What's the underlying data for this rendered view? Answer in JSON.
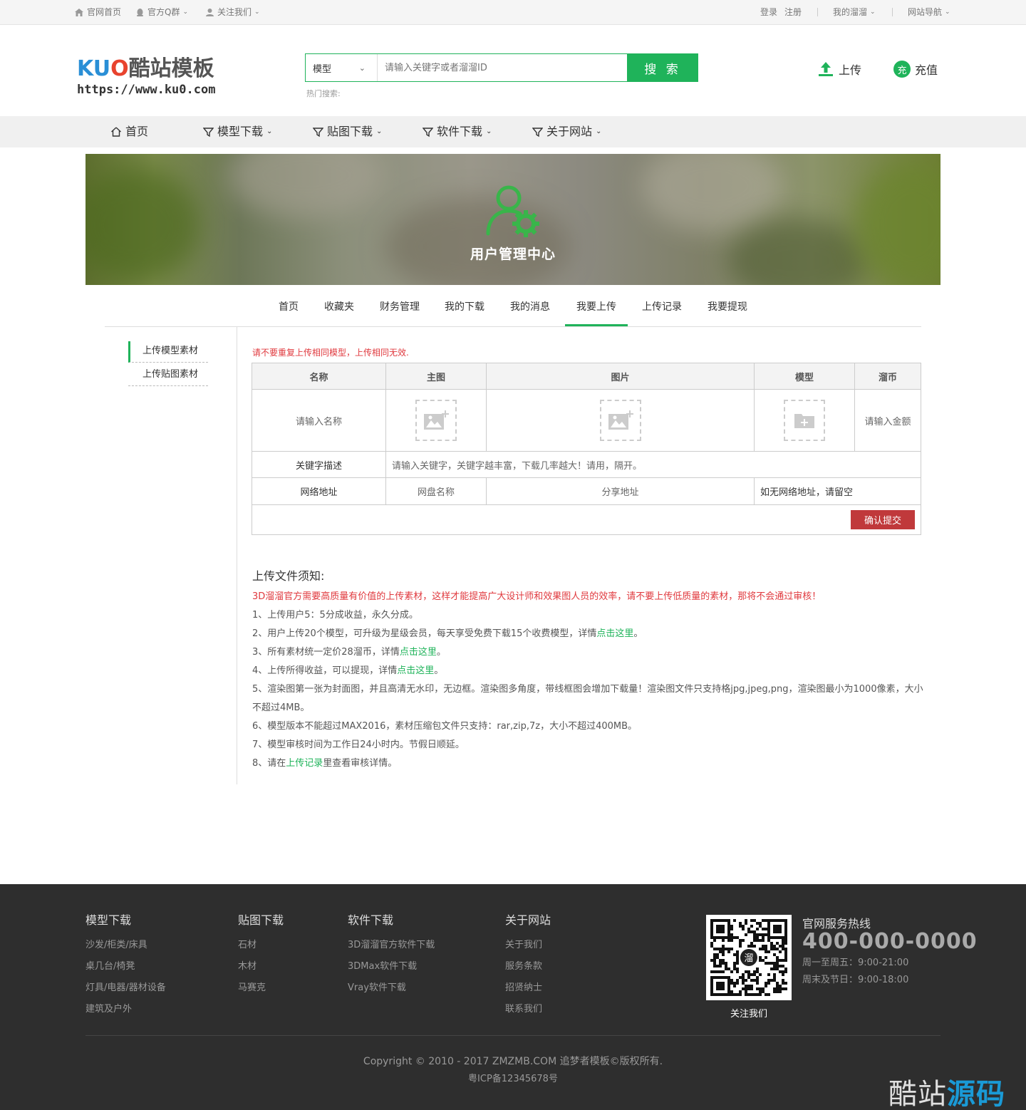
{
  "topbar": {
    "home": "官网首页",
    "qq": "官方Q群",
    "follow": "关注我们",
    "login": "登录",
    "register": "注册",
    "my": "我的溜溜",
    "nav": "网站导航"
  },
  "header": {
    "logo_text": "KUO酷站模板",
    "logo_url": "https://www.ku0.com",
    "search_category": "模型",
    "search_placeholder": "请输入关键字或者溜溜ID",
    "search_button": "搜 索",
    "hot_search": "热门搜索:",
    "upload": "上传",
    "recharge_badge": "充",
    "recharge": "充值"
  },
  "nav": [
    {
      "label": "首页"
    },
    {
      "label": "模型下载"
    },
    {
      "label": "贴图下载"
    },
    {
      "label": "软件下载"
    },
    {
      "label": "关于网站"
    }
  ],
  "banner": {
    "title": "用户管理中心"
  },
  "tabs": [
    "首页",
    "收藏夹",
    "财务管理",
    "我的下载",
    "我的消息",
    "我要上传",
    "上传记录",
    "我要提现"
  ],
  "sidebar": [
    "上传模型素材",
    "上传贴图素材"
  ],
  "form": {
    "warning": "请不要重复上传相同模型，上传相同无效.",
    "headers": [
      "名称",
      "主图",
      "图片",
      "模型",
      "溜币"
    ],
    "name_placeholder": "请输入名称",
    "price_placeholder": "请输入金额",
    "keyword_label": "关键字描述",
    "keyword_placeholder": "请输入关键字，关键字越丰富，下载几率越大！请用，隔开。",
    "net_label": "网络地址",
    "net_name_placeholder": "网盘名称",
    "net_url_placeholder": "分享地址",
    "net_hint": "如无网络地址，请留空",
    "submit": "确认提交"
  },
  "notice": {
    "title": "上传文件须知:",
    "intro": "3D溜溜官方需要高质量有价值的上传素材，这样才能提高广大设计师和效果图人员的效率，请不要上传低质量的素材，那将不会通过审核！",
    "l1": "1、上传用户5：5分成收益，永久分成。",
    "l2a": "2、用户上传20个模型，可升级为星级会员，每天享受免费下载15个收费模型，详情",
    "l2link": "点击这里",
    "l2b": "。",
    "l3a": "3、所有素材统一定价28溜币，详情",
    "l3link": "点击这里",
    "l3b": "。",
    "l4a": "4、上传所得收益，可以提现，详情",
    "l4link": "点击这里",
    "l4b": "。",
    "l5": "5、渲染图第一张为封面图，并且高清无水印，无边框。渲染图多角度，带线框图会增加下载量！渲染图文件只支持格jpg,jpeg,png，渲染图最小为1000像素，大小不超过4MB。",
    "l6": "6、模型版本不能超过MAX2016，素材压缩包文件只支持：rar,zip,7z，大小不超过400MB。",
    "l7": "7、模型审核时间为工作日24小时内。节假日顺延。",
    "l8a": "8、请在",
    "l8link": "上传记录",
    "l8b": "里查看审核详情。"
  },
  "footer": {
    "cols": [
      {
        "title": "模型下载",
        "items": [
          "沙发/柜类/床具",
          "桌几台/椅凳",
          "灯具/电器/器材设备",
          "建筑及户外"
        ]
      },
      {
        "title": "贴图下载",
        "items": [
          "石材",
          "木材",
          "马赛克"
        ]
      },
      {
        "title": "软件下载",
        "items": [
          "3D溜溜官方软件下载",
          "3DMax软件下载",
          "Vray软件下载"
        ]
      },
      {
        "title": "关于网站",
        "items": [
          "关于我们",
          "服务条款",
          "招贤纳士",
          "联系我们"
        ]
      }
    ],
    "qr_center": "溜",
    "qr_caption": "关注我们",
    "hotline_title": "官网服务热线",
    "phone": "400-000-0000",
    "time1": "周一至周五：9:00-21:00",
    "time2": "周末及节日：9:00-18:00",
    "copyright": "Copyright © 2010 - 2017 ZMZMB.COM 追梦者模板©版权所有.",
    "icp": "粤ICP备12345678号",
    "watermark_a": "酷站",
    "watermark_b": "源码"
  },
  "colors": {
    "accent": "#1fb35a",
    "red": "#e0393e",
    "submit": "#c0393b",
    "footer_bg": "#2e2e2e"
  }
}
